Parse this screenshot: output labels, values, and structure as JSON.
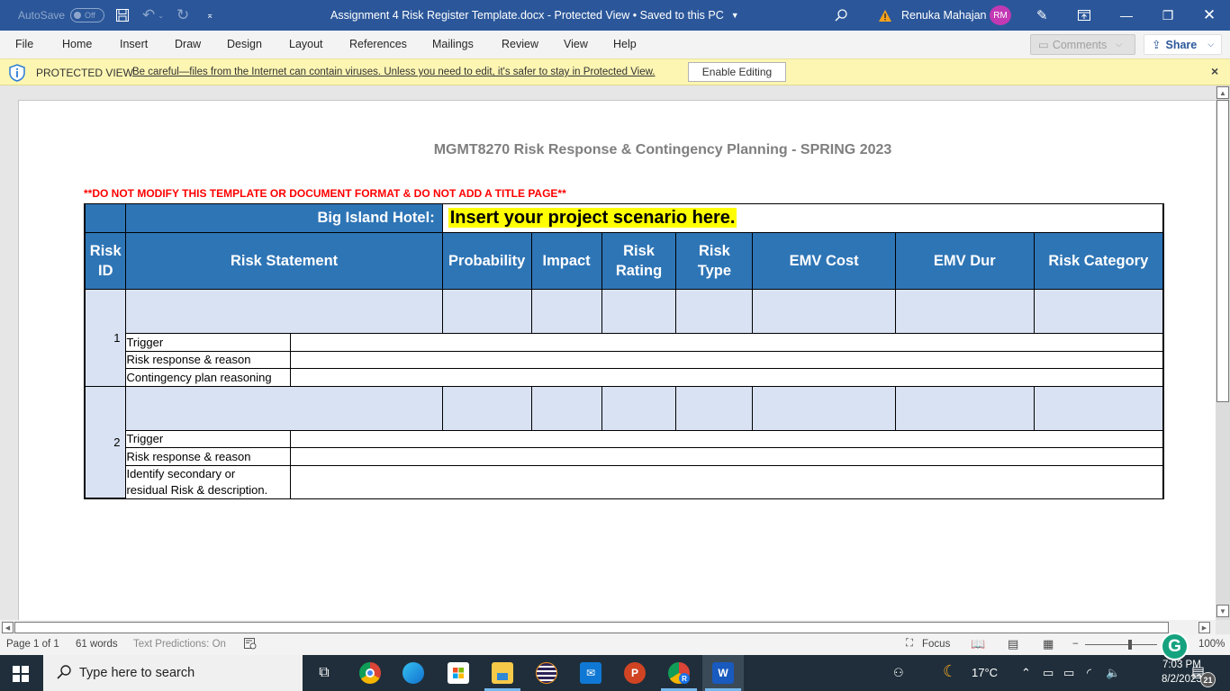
{
  "titlebar": {
    "autosave_label": "AutoSave",
    "autosave_state": "Off",
    "document_title": "Assignment 4 Risk Register Template.docx  -  Protected View • Saved to this PC",
    "user_name": "Renuka Mahajan",
    "user_initials": "RM",
    "icons": [
      "save-icon",
      "undo-icon",
      "redo-icon",
      "customize-qat-icon",
      "search-icon",
      "warning-icon",
      "pen-icon",
      "ribbon-display-icon",
      "minimize-icon",
      "restore-icon",
      "close-icon"
    ]
  },
  "menu": {
    "items": [
      "File",
      "Home",
      "Insert",
      "Draw",
      "Design",
      "Layout",
      "References",
      "Mailings",
      "Review",
      "View",
      "Help"
    ],
    "comments_label": "Comments",
    "share_label": "Share"
  },
  "protected_view": {
    "label": "PROTECTED VIEW",
    "message": "Be careful—files from the Internet can contain viruses. Unless you need to edit, it's safer to stay in Protected View.",
    "enable_button": "Enable Editing",
    "close": "×"
  },
  "document": {
    "heading": "MGMT8270 Risk Response & Contingency Planning - SPRING 2023",
    "warning": "**DO NOT MODIFY THIS TEMPLATE OR DOCUMENT FORMAT & DO NOT ADD A TITLE PAGE**",
    "table": {
      "project_label": "Big Island Hotel:",
      "project_scenario": "Insert your project scenario here.",
      "headers": {
        "risk_id": [
          "Risk",
          "ID"
        ],
        "risk_statement": "Risk Statement",
        "probability": "Probability",
        "impact": "Impact",
        "risk_rating": [
          "Risk",
          "Rating"
        ],
        "risk_type": [
          "Risk",
          "Type"
        ],
        "emv_cost": "EMV Cost",
        "emv_dur": "EMV Dur",
        "risk_category": "Risk Category"
      },
      "risks": [
        {
          "id": "1",
          "rows": [
            "Trigger",
            "Risk response & reason",
            "Contingency plan reasoning"
          ]
        },
        {
          "id": "2",
          "rows": [
            "Trigger",
            "Risk response & reason",
            "Identify secondary or",
            "residual Risk & description."
          ]
        }
      ]
    }
  },
  "statusbar": {
    "page": "Page 1 of 1",
    "words": "61 words",
    "text_predictions": "Text Predictions: On",
    "focus": "Focus",
    "zoom_percent": "100%",
    "zoom_minus": "−"
  },
  "taskbar": {
    "search_placeholder": "Type here to search",
    "weather": "17°C",
    "time": "7:03 PM",
    "date": "8/2/2023",
    "notifications_count": "21",
    "apps": [
      "task-view",
      "chrome",
      "edge",
      "microsoft-store",
      "file-explorer",
      "eclipse",
      "mail",
      "powerpoint",
      "chrome-profile",
      "word"
    ]
  },
  "colors": {
    "word_blue": "#2b579a",
    "header_blue": "#2e75b6",
    "row_light_blue": "#d9e2f3",
    "protected_yellow": "#fdf6b3",
    "highlight_yellow": "#ffff00",
    "warning_red": "#ff0000",
    "avatar_magenta": "#c239b3"
  }
}
